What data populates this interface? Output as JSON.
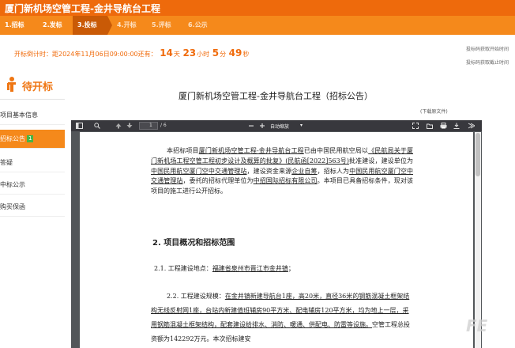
{
  "header": {
    "title": "厦门新机场空管工程-金井导航台工程"
  },
  "steps": [
    {
      "label": "1.招标"
    },
    {
      "label": "2.发标"
    },
    {
      "label": "3.投标"
    },
    {
      "label": "4.开标"
    },
    {
      "label": "5.评标"
    },
    {
      "label": "6.公示"
    }
  ],
  "countdown": {
    "prefix": "开标倒计时：距2024年11月06日09:00:00还有：",
    "days": "14",
    "days_unit": "天",
    "hours": "23",
    "hours_unit": "小时",
    "minutes": "5",
    "minutes_unit": "分",
    "seconds": "49",
    "seconds_unit": "秒"
  },
  "right_links": {
    "start": "投标码获取开始时间",
    "end": "投标码获取截止时间"
  },
  "sidebar": {
    "header": "待开标",
    "items": [
      {
        "label": "项目基本信息"
      },
      {
        "label": "招标公告",
        "badge": "1"
      },
      {
        "label": "答疑"
      },
      {
        "label": "中标公示"
      },
      {
        "label": "购买保函"
      }
    ]
  },
  "document": {
    "title": "厦门新机场空管工程-金井导航台工程（招标公告）",
    "download_label": "(下载原文件)"
  },
  "viewer": {
    "page_current": "1",
    "page_total": "/ 6",
    "zoom": "自动缩放",
    "icons": [
      "sidebar-toggle-icon",
      "search-icon",
      "page-up-icon",
      "page-down-icon",
      "zoom-out-icon",
      "zoom-in-icon",
      "fullscreen-icon",
      "open-file-icon",
      "print-icon",
      "download-icon",
      "tools-icon"
    ]
  },
  "pdf": {
    "para_1a": "本招标项目",
    "para_1b": "厦门新机场空管工程-金井导航台工程",
    "para_1c": "已由中国民用航空局以",
    "para_1d": "《民航局关于厦门新机场工程空管工程初步设计及概算的批复》(民航函[2022]563号)",
    "para_1e": "批准建设，建设单位为",
    "para_1f": "中国民用航空厦门空中交通管理站",
    "para_1g": "，建设资金来源",
    "para_1h": "企业自筹",
    "para_1i": "，招标人为",
    "para_1j": "中国民用航空厦门空中交通管理站",
    "para_1k": "，委托的招标代理单位为",
    "para_1l": "中招国际招标有限公司",
    "para_1m": "。本项目已具备招标条件，现对该项目的施工进行公开招标。",
    "heading": "2.  项目概况和招标范围",
    "item_1_label": "2.1.  工程建设地点：",
    "item_1_value": "福建省泉州市晋江市金井镇",
    "item_1_end": "；",
    "item_2a": "2.2.  工程建设规模：",
    "item_2b": "在金井镇新建导航台1座，高20米，直径36米的钢筋混凝土框架结构无线反射网1座，台站内新建值班辅房90平方米、配电辅房120平方米，均为地上一层，采用钢筋混凝土框架结构，配套建设给排水、消防、暖通、供配电、防雷等设施。",
    "item_2c": "空管工程总投资额为142292万元。本次招标建安"
  },
  "watermark": "FE"
}
